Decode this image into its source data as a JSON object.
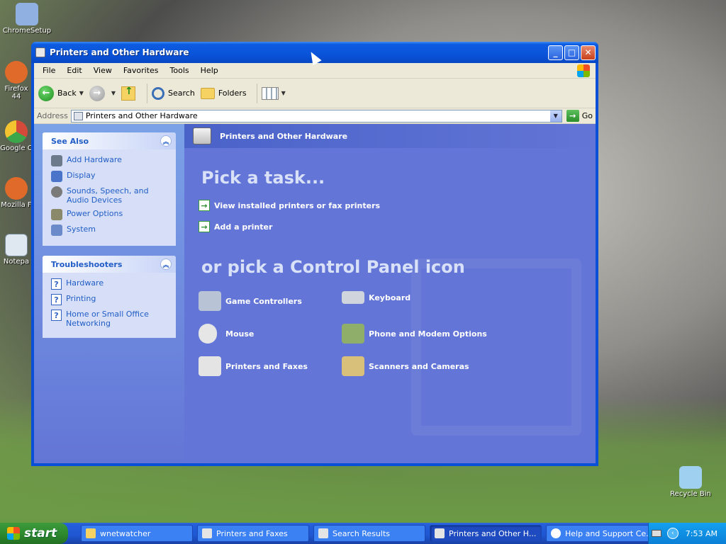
{
  "desktop": {
    "icons": [
      {
        "label": "ChromeSetup",
        "icon": "installer-icon",
        "color": "#8fb0e0"
      },
      {
        "label": "Firefox 44",
        "icon": "firefox-icon",
        "color": "#e06a2a"
      },
      {
        "label": "Google C",
        "icon": "chrome-icon",
        "color": "#d44a3a"
      },
      {
        "label": "Mozilla F",
        "icon": "firefox-icon",
        "color": "#e06a2a"
      },
      {
        "label": "Notepa",
        "icon": "notepad-icon",
        "color": "#dfe8f0"
      },
      {
        "label": "Recycle Bin",
        "icon": "recycle-bin-icon",
        "color": "#9fd0ef"
      }
    ]
  },
  "window": {
    "title": "Printers and Other Hardware",
    "controls": {
      "minimize": "_",
      "maximize": "□",
      "close": "✕"
    },
    "menu": [
      "File",
      "Edit",
      "View",
      "Favorites",
      "Tools",
      "Help"
    ],
    "toolbar": {
      "back": "Back",
      "search": "Search",
      "folders": "Folders"
    },
    "address": {
      "label": "Address",
      "value": "Printers and Other Hardware",
      "go": "Go"
    }
  },
  "left_pane": {
    "see_also": {
      "title": "See Also",
      "items": [
        {
          "label": "Add Hardware",
          "icon": "add-hardware-icon",
          "color": "#6d7a8c"
        },
        {
          "label": "Display",
          "icon": "display-icon",
          "color": "#4a74c9"
        },
        {
          "label": "Sounds, Speech, and Audio Devices",
          "icon": "speaker-icon",
          "color": "#7a7a7a"
        },
        {
          "label": "Power Options",
          "icon": "power-icon",
          "color": "#8a8a6a"
        },
        {
          "label": "System",
          "icon": "system-icon",
          "color": "#6a8ac9"
        }
      ]
    },
    "troubleshooters": {
      "title": "Troubleshooters",
      "items": [
        {
          "label": "Hardware"
        },
        {
          "label": "Printing"
        },
        {
          "label": "Home or Small Office Networking"
        }
      ]
    }
  },
  "right_pane": {
    "header": "Printers and Other Hardware",
    "pick_task": "Pick a task...",
    "tasks": [
      "View installed printers or fax printers",
      "Add a printer"
    ],
    "pick_icon": "or pick a Control Panel icon",
    "icons": [
      {
        "label": "Game Controllers",
        "icon": "gamepad-icon",
        "color": "#b9c3d6"
      },
      {
        "label": "Keyboard",
        "icon": "keyboard-icon",
        "color": "#d0d4dc"
      },
      {
        "label": "Mouse",
        "icon": "mouse-icon",
        "color": "#e6e6e6"
      },
      {
        "label": "Phone and Modem Options",
        "icon": "phone-modem-icon",
        "color": "#8fae6a"
      },
      {
        "label": "Printers and Faxes",
        "icon": "printer-icon",
        "color": "#e4e4e4"
      },
      {
        "label": "Scanners and Cameras",
        "icon": "scanner-icon",
        "color": "#d9c07a"
      }
    ]
  },
  "taskbar": {
    "start": "start",
    "buttons": [
      {
        "label": "wnetwatcher",
        "icon": "folder-icon",
        "color": "#f5d262",
        "active": false
      },
      {
        "label": "Printers and Faxes",
        "icon": "printer-icon",
        "color": "#e4e4e4",
        "active": false
      },
      {
        "label": "Search Results",
        "icon": "search-results-icon",
        "color": "#e4e4e4",
        "active": false
      },
      {
        "label": "Printers and Other H...",
        "icon": "printer-icon",
        "color": "#e4e4e4",
        "active": true
      },
      {
        "label": "Help and Support Ce...",
        "icon": "help-icon",
        "color": "#3c81f3",
        "active": false
      }
    ],
    "clock": "7:53 AM"
  }
}
